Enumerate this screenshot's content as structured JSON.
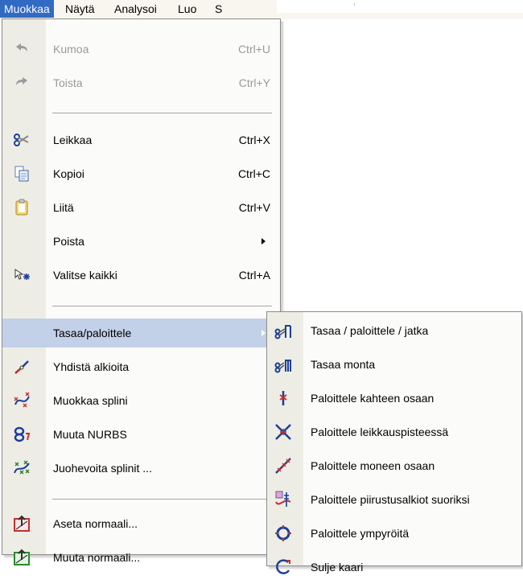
{
  "menubar": {
    "items": [
      "Muokkaa",
      "Näytä",
      "Analysoi",
      "Luo",
      "S"
    ]
  },
  "menu": {
    "items": [
      {
        "label": "Kumoa",
        "shortcut": "Ctrl+U",
        "icon": "undo-icon",
        "disabled": true
      },
      {
        "label": "Toista",
        "shortcut": "Ctrl+Y",
        "icon": "redo-icon",
        "disabled": true
      },
      {
        "label": "Leikkaa",
        "shortcut": "Ctrl+X",
        "icon": "scissors-icon"
      },
      {
        "label": "Kopioi",
        "shortcut": "Ctrl+C",
        "icon": "copy-icon"
      },
      {
        "label": "Liitä",
        "shortcut": "Ctrl+V",
        "icon": "paste-icon"
      },
      {
        "label": "Poista",
        "shortcut": "",
        "icon": "",
        "submenu": true
      },
      {
        "label": "Valitse kaikki",
        "shortcut": "Ctrl+A",
        "icon": "select-all-icon"
      },
      {
        "label": "Tasaa/paloittele",
        "shortcut": "",
        "icon": "",
        "submenu": true,
        "highlighted": true
      },
      {
        "label": "Yhdistä alkioita",
        "shortcut": "",
        "icon": "join-icon"
      },
      {
        "label": "Muokkaa splini",
        "shortcut": "",
        "icon": "edit-spline-icon"
      },
      {
        "label": "Muuta NURBS",
        "shortcut": "",
        "icon": "nurbs-icon"
      },
      {
        "label": "Juohevoita splinit ...",
        "shortcut": "",
        "icon": "smooth-spline-icon"
      },
      {
        "label": "Aseta normaali...",
        "shortcut": "",
        "icon": "set-normal-icon"
      },
      {
        "label": "Muuta normaali...",
        "shortcut": "",
        "icon": "change-normal-icon"
      }
    ]
  },
  "submenu": {
    "items": [
      {
        "label": "Tasaa / paloittele / jatka",
        "icon": "trim-divide-extend-icon"
      },
      {
        "label": "Tasaa monta",
        "icon": "trim-many-icon"
      },
      {
        "label": "Paloittele kahteen osaan",
        "icon": "divide-two-icon"
      },
      {
        "label": "Paloittele leikkauspisteessä",
        "icon": "divide-intersection-icon"
      },
      {
        "label": "Paloittele moneen osaan",
        "icon": "divide-many-icon"
      },
      {
        "label": "Paloittele piirustusalkiot suoriksi",
        "icon": "divide-to-lines-icon"
      },
      {
        "label": "Paloittele ympyröitä",
        "icon": "divide-circles-icon"
      },
      {
        "label": "Sulje kaari",
        "icon": "close-arc-icon"
      }
    ]
  },
  "colors": {
    "menu_highlight": "#316ac5",
    "item_highlight": "#c2d0e8",
    "gutter": "#eeede5",
    "disabled_text": "#9a9a9a"
  }
}
